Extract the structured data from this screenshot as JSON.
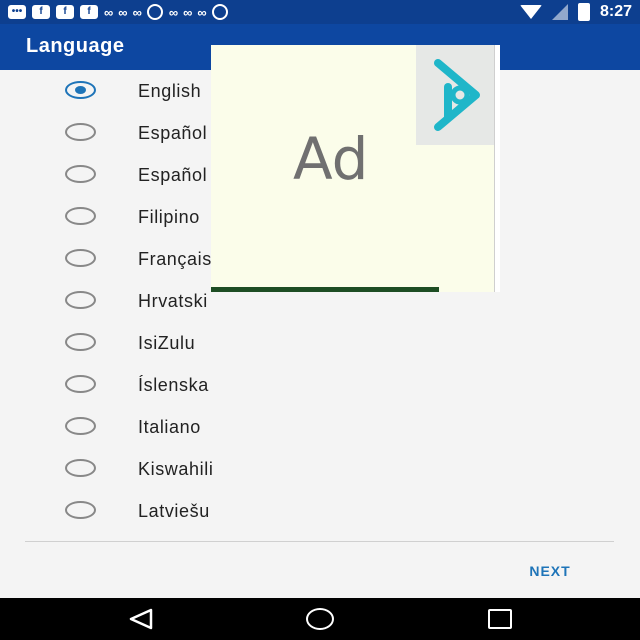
{
  "status_bar": {
    "time": "8:27",
    "left_icons": [
      "chat-icon",
      "facebook-icon",
      "facebook-icon",
      "facebook-icon",
      "infinity-icon",
      "infinity-icon",
      "infinity-icon",
      "whatsapp-icon",
      "infinity-icon",
      "infinity-icon",
      "infinity-icon",
      "pinterest-icon"
    ],
    "right_icons": [
      "wifi-icon",
      "signal-icon",
      "battery-charging-icon"
    ]
  },
  "app_bar": {
    "title": "Language"
  },
  "languages": [
    {
      "label": "English",
      "selected": true
    },
    {
      "label": "Español",
      "selected": false
    },
    {
      "label": "Español",
      "selected": false
    },
    {
      "label": "Filipino",
      "selected": false
    },
    {
      "label": "Français",
      "selected": false
    },
    {
      "label": "Hrvatski",
      "selected": false
    },
    {
      "label": "IsiZulu",
      "selected": false
    },
    {
      "label": "Íslenska",
      "selected": false
    },
    {
      "label": "Italiano",
      "selected": false
    },
    {
      "label": "Kiswahili",
      "selected": false
    },
    {
      "label": "Latviešu",
      "selected": false
    }
  ],
  "footer": {
    "next_label": "NEXT"
  },
  "ad": {
    "label": "Ad",
    "logo": "play-logo-icon"
  },
  "nav_bar": {
    "buttons": [
      "back-icon",
      "home-icon",
      "recents-icon"
    ]
  },
  "colors": {
    "primary": "#0d47a1",
    "accent": "#1e74b8",
    "background": "#f4f4f4"
  }
}
